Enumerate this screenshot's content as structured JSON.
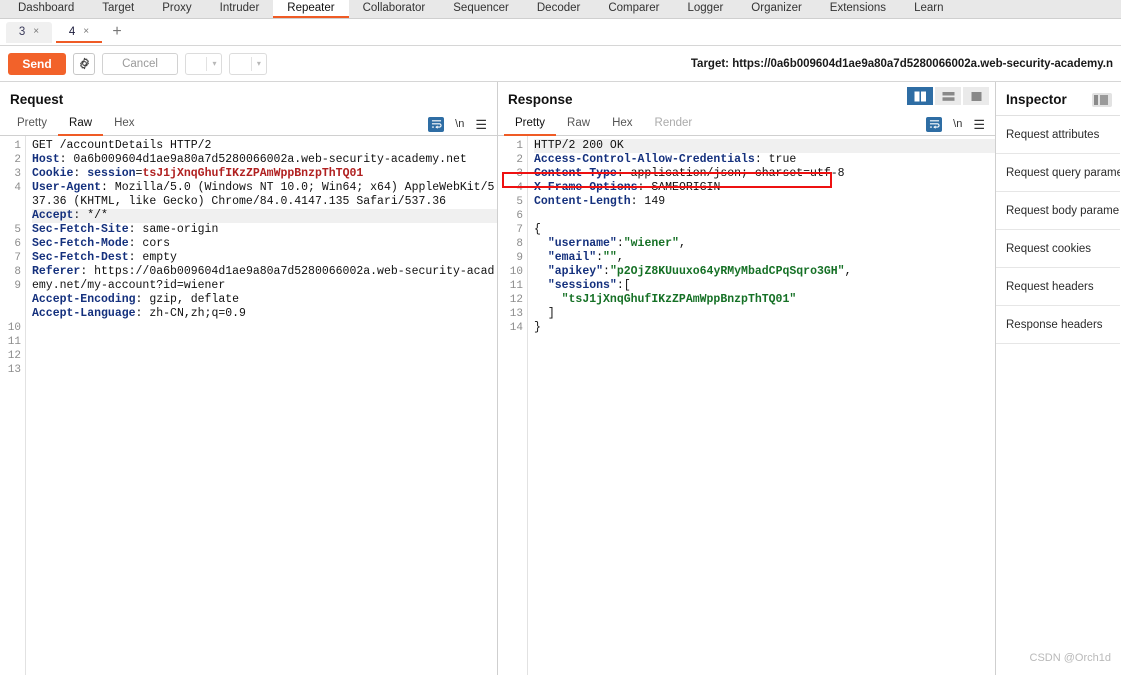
{
  "topnav": {
    "items": [
      {
        "label": "Dashboard",
        "active": false
      },
      {
        "label": "Target",
        "active": false
      },
      {
        "label": "Proxy",
        "active": false
      },
      {
        "label": "Intruder",
        "active": false
      },
      {
        "label": "Repeater",
        "active": true
      },
      {
        "label": "Collaborator",
        "active": false
      },
      {
        "label": "Sequencer",
        "active": false
      },
      {
        "label": "Decoder",
        "active": false
      },
      {
        "label": "Comparer",
        "active": false
      },
      {
        "label": "Logger",
        "active": false
      },
      {
        "label": "Organizer",
        "active": false
      },
      {
        "label": "Extensions",
        "active": false
      },
      {
        "label": "Learn",
        "active": false
      }
    ]
  },
  "repeater_tabs": {
    "tabs": [
      {
        "label": "3",
        "close": "×",
        "active": false
      },
      {
        "label": "4",
        "close": "×",
        "active": true
      }
    ],
    "add_label": "+"
  },
  "actionbar": {
    "send_label": "Send",
    "settings_icon": "gear-icon",
    "cancel_label": "Cancel",
    "prev_label": "<",
    "next_label": ">",
    "caret": "▾",
    "target_text": "Target: https://0a6b009604d1ae9a80a7d5280066002a.web-security-academy.n"
  },
  "request": {
    "title": "Request",
    "tabs": [
      {
        "label": "Pretty",
        "active": false,
        "disabled": false
      },
      {
        "label": "Raw",
        "active": true,
        "disabled": false
      },
      {
        "label": "Hex",
        "active": false,
        "disabled": false
      }
    ],
    "tools": {
      "wrap": "word-wrap-icon",
      "newline": "\\n",
      "menu": "hamburger-menu-icon"
    },
    "line_numbers": [
      "1",
      "2",
      "3",
      "4",
      "",
      "",
      "5",
      "6",
      "7",
      "8",
      "9",
      "",
      "",
      "10",
      "11",
      "12",
      "13"
    ],
    "lines": [
      {
        "segments": [
          {
            "t": "GET /accountDetails HTTP/2",
            "c": "plain"
          }
        ]
      },
      {
        "segments": [
          {
            "t": "Host",
            "c": "hdr"
          },
          {
            "t": ": 0a6b009604d1ae9a80a7d5280066002a.web-security-academy.net",
            "c": "plain"
          }
        ]
      },
      {
        "segments": [
          {
            "t": "Cookie",
            "c": "hdr"
          },
          {
            "t": ": ",
            "c": "plain"
          },
          {
            "t": "session",
            "c": "hdr-sub"
          },
          {
            "t": "=",
            "c": "plain"
          },
          {
            "t": "tsJ1jXnqGhufIKzZPAmWppBnzpThTQ01",
            "c": "val-red"
          }
        ]
      },
      {
        "segments": [
          {
            "t": "User-Agent",
            "c": "hdr"
          },
          {
            "t": ": Mozilla/5.0 (Windows NT 10.0; Win64; x64) AppleWebKit/537.36 (KHTML, like Gecko) Chrome/84.0.4147.135 Safari/537.36",
            "c": "plain"
          }
        ]
      },
      {
        "segments": [
          {
            "t": "Accept",
            "c": "hdr"
          },
          {
            "t": ": */*",
            "c": "plain"
          }
        ],
        "highlight": true
      },
      {
        "segments": [
          {
            "t": "Sec-Fetch-Site",
            "c": "hdr"
          },
          {
            "t": ": same-origin",
            "c": "plain"
          }
        ]
      },
      {
        "segments": [
          {
            "t": "Sec-Fetch-Mode",
            "c": "hdr"
          },
          {
            "t": ": cors",
            "c": "plain"
          }
        ]
      },
      {
        "segments": [
          {
            "t": "Sec-Fetch-Dest",
            "c": "hdr"
          },
          {
            "t": ": empty",
            "c": "plain"
          }
        ]
      },
      {
        "segments": [
          {
            "t": "Referer",
            "c": "hdr"
          },
          {
            "t": ": https://0a6b009604d1ae9a80a7d5280066002a.web-security-academy.net/my-account?id=wiener",
            "c": "plain"
          }
        ]
      },
      {
        "segments": [
          {
            "t": "Accept-Encoding",
            "c": "hdr"
          },
          {
            "t": ": gzip, deflate",
            "c": "plain"
          }
        ]
      },
      {
        "segments": [
          {
            "t": "Accept-Language",
            "c": "hdr"
          },
          {
            "t": ": zh-CN,zh;q=0.9",
            "c": "plain"
          }
        ]
      },
      {
        "segments": [
          {
            "t": "",
            "c": "plain"
          }
        ]
      },
      {
        "segments": [
          {
            "t": "",
            "c": "plain"
          }
        ]
      }
    ]
  },
  "response": {
    "title": "Response",
    "layout_buttons": [
      {
        "name": "vertical-split-layout-button",
        "active": true
      },
      {
        "name": "horizontal-split-layout-button",
        "active": false
      },
      {
        "name": "single-pane-layout-button",
        "active": false
      }
    ],
    "tabs": [
      {
        "label": "Pretty",
        "active": true,
        "disabled": false
      },
      {
        "label": "Raw",
        "active": false,
        "disabled": false
      },
      {
        "label": "Hex",
        "active": false,
        "disabled": false
      },
      {
        "label": "Render",
        "active": false,
        "disabled": true
      }
    ],
    "tools": {
      "wrap": "word-wrap-icon",
      "newline": "\\n",
      "menu": "hamburger-menu-icon"
    },
    "line_numbers": [
      "1",
      "2",
      "3",
      "4",
      "5",
      "6",
      "7",
      "8",
      "9",
      "10",
      "11",
      "12",
      "13",
      "14"
    ],
    "lines": [
      {
        "segments": [
          {
            "t": "HTTP/2 200 OK",
            "c": "plain"
          }
        ],
        "highlight": true
      },
      {
        "segments": [
          {
            "t": "Access-Control-Allow-Credentials",
            "c": "hdr"
          },
          {
            "t": ": true",
            "c": "plain"
          }
        ],
        "annotated": true
      },
      {
        "segments": [
          {
            "t": "Content-Type",
            "c": "hdr"
          },
          {
            "t": ": application/json; charset=utf-8",
            "c": "plain"
          }
        ]
      },
      {
        "segments": [
          {
            "t": "X-Frame-Options",
            "c": "hdr"
          },
          {
            "t": ": SAMEORIGIN",
            "c": "plain"
          }
        ]
      },
      {
        "segments": [
          {
            "t": "Content-Length",
            "c": "hdr"
          },
          {
            "t": ": 149",
            "c": "plain"
          }
        ]
      },
      {
        "segments": [
          {
            "t": "",
            "c": "plain"
          }
        ]
      },
      {
        "segments": [
          {
            "t": "{",
            "c": "plain"
          }
        ]
      },
      {
        "segments": [
          {
            "t": "  ",
            "c": "plain"
          },
          {
            "t": "\"username\"",
            "c": "hdr"
          },
          {
            "t": ":",
            "c": "plain"
          },
          {
            "t": "\"wiener\"",
            "c": "val-green"
          },
          {
            "t": ",",
            "c": "plain"
          }
        ]
      },
      {
        "segments": [
          {
            "t": "  ",
            "c": "plain"
          },
          {
            "t": "\"email\"",
            "c": "hdr"
          },
          {
            "t": ":",
            "c": "plain"
          },
          {
            "t": "\"\"",
            "c": "val-green"
          },
          {
            "t": ",",
            "c": "plain"
          }
        ]
      },
      {
        "segments": [
          {
            "t": "  ",
            "c": "plain"
          },
          {
            "t": "\"apikey\"",
            "c": "hdr"
          },
          {
            "t": ":",
            "c": "plain"
          },
          {
            "t": "\"p2OjZ8KUuuxo64yRMyMbadCPqSqro3GH\"",
            "c": "val-green"
          },
          {
            "t": ",",
            "c": "plain"
          }
        ]
      },
      {
        "segments": [
          {
            "t": "  ",
            "c": "plain"
          },
          {
            "t": "\"sessions\"",
            "c": "hdr"
          },
          {
            "t": ":[",
            "c": "plain"
          }
        ]
      },
      {
        "segments": [
          {
            "t": "    ",
            "c": "plain"
          },
          {
            "t": "\"tsJ1jXnqGhufIKzZPAmWppBnzpThTQ01\"",
            "c": "val-green"
          }
        ]
      },
      {
        "segments": [
          {
            "t": "  ]",
            "c": "plain"
          }
        ]
      },
      {
        "segments": [
          {
            "t": "}",
            "c": "plain"
          }
        ]
      }
    ]
  },
  "inspector": {
    "title": "Inspector",
    "toggle_icon": "collapse-panel-icon",
    "items": [
      {
        "label": "Request attributes"
      },
      {
        "label": "Request query parame"
      },
      {
        "label": "Request body parame"
      },
      {
        "label": "Request cookies"
      },
      {
        "label": "Request headers"
      },
      {
        "label": "Response headers"
      }
    ]
  },
  "watermark": {
    "text": "CSDN @Orch1d"
  },
  "colors": {
    "accent_orange": "#ef5b25",
    "send_orange": "#f2622a",
    "header_blue": "#14307d",
    "string_green": "#157025",
    "cookie_red": "#b02020",
    "annotation_red": "#ee1111",
    "active_layout_blue": "#2e6da4"
  }
}
